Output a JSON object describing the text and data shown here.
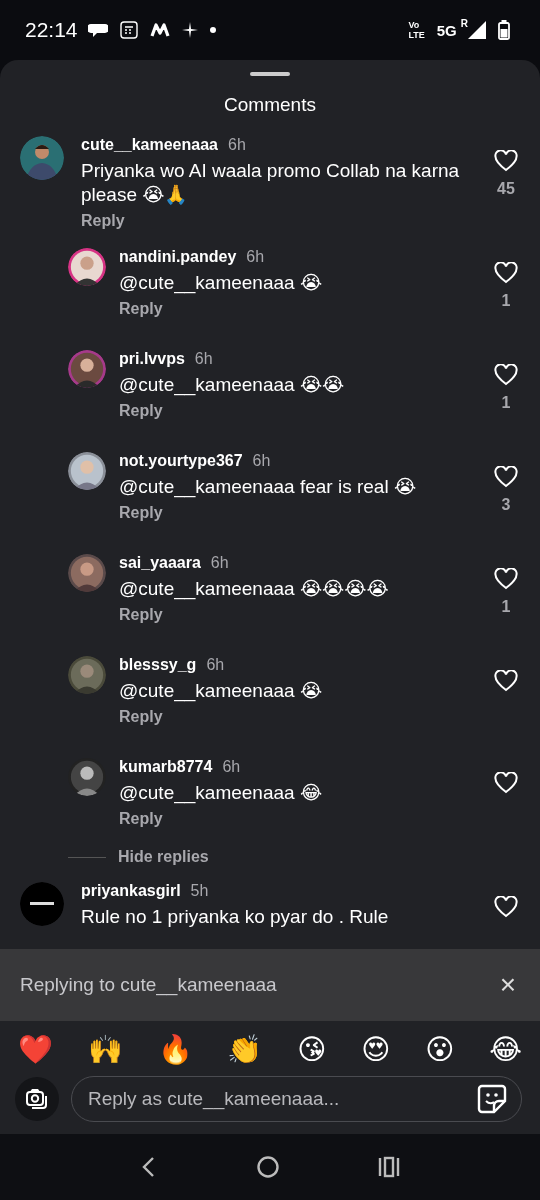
{
  "status_bar": {
    "time": "22:14",
    "network": "5G",
    "roaming": "R",
    "volte_top": "Vo",
    "volte_bottom": "LTE"
  },
  "sheet": {
    "title": "Comments"
  },
  "comments": [
    {
      "user": "cute__kameenaaa",
      "time": "6h",
      "text": "Priyanka wo AI waala promo Collab na karna please 😭🙏",
      "reply": "Reply",
      "likes": "45",
      "hide_replies": "Hide replies",
      "replies": [
        {
          "user": "nandini.pandey",
          "time": "6h",
          "text": "@cute__kameenaaa 😭",
          "reply": "Reply",
          "likes": "1"
        },
        {
          "user": "pri.lvvps",
          "time": "6h",
          "text": "@cute__kameenaaa 😭😭",
          "reply": "Reply",
          "likes": "1"
        },
        {
          "user": "not.yourtype367",
          "time": "6h",
          "text": "@cute__kameenaaa fear is real 😭",
          "reply": "Reply",
          "likes": "3"
        },
        {
          "user": "sai_yaaara",
          "time": "6h",
          "text": "@cute__kameenaaa 😭😭😭😭",
          "reply": "Reply",
          "likes": "1"
        },
        {
          "user": "blesssy_g",
          "time": "6h",
          "text": "@cute__kameenaaa 😭",
          "reply": "Reply"
        },
        {
          "user": "kumarb8774",
          "time": "6h",
          "text": "@cute__kameenaaa 😂",
          "reply": "Reply"
        }
      ]
    },
    {
      "user": "priyankasgirl",
      "time": "5h",
      "text": "Rule no 1 priyanka ko pyar do . Rule"
    }
  ],
  "replying_bar": {
    "text": "Replying to cute__kameenaaa",
    "close": "×"
  },
  "quick_reactions": [
    "❤️",
    "🙌",
    "🔥",
    "👏",
    "😘",
    "😍",
    "😮",
    "😂"
  ],
  "composer": {
    "placeholder": "Reply as cute__kameenaaa..."
  }
}
